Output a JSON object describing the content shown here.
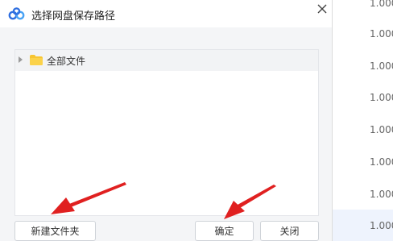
{
  "dialog": {
    "title": "选择网盘保存路径",
    "close_icon": "close-icon"
  },
  "tree": {
    "root_label": "全部文件",
    "root_icon": "folder-icon",
    "expander_icon": "expand-arrow-icon"
  },
  "buttons": {
    "new_folder": "新建文件夹",
    "confirm": "确定",
    "close": "关闭"
  },
  "background_list": {
    "values": [
      "1.000",
      "1.000",
      "1.000",
      "1.000",
      "1.000",
      "1.000",
      "1.000",
      "1.000"
    ],
    "selected_index": 7
  },
  "colors": {
    "annotation_arrow": "#e02020",
    "folder": "#f7c531",
    "logo": "#2f6fe0"
  }
}
